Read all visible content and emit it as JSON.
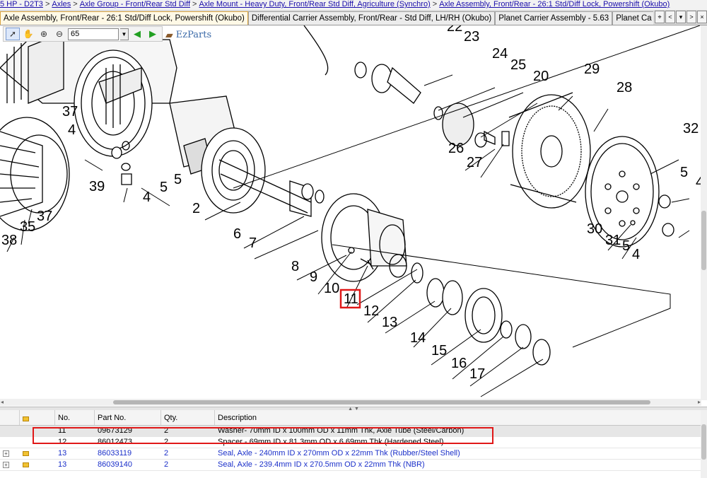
{
  "breadcrumb": {
    "items": [
      "5 HP - D2T3",
      "Axles",
      "Axle Group - Front/Rear Std Diff",
      "Axle Mount - Heavy Duty, Front/Rear Std Diff, Agriculture (Synchro)",
      "Axle Assembly, Front/Rear - 26:1 Std/Diff Lock, Powershift (Okubo)"
    ],
    "separator": ">"
  },
  "tabs": [
    {
      "label": "Axle Assembly, Front/Rear - 26:1 Std/Diff Lock, Powershift (Okubo)",
      "active": true
    },
    {
      "label": "Differential Carrier Assembly, Front/Rear - Std Diff, LH/RH (Okubo)",
      "active": false
    },
    {
      "label": "Planet Carrier Assembly - 5.63",
      "active": false
    },
    {
      "label": "Planet Ca",
      "active": false
    }
  ],
  "tab_controls": {
    "pin": "⌖",
    "prev": "<",
    "menu": "▾",
    "next": ">",
    "close": "×"
  },
  "toolbar": {
    "zoom_value": "65",
    "icons": [
      "pointer-icon",
      "pan-hand-icon",
      "zoom-in-icon",
      "zoom-out-icon",
      "back-arrow-icon",
      "forward-arrow-icon"
    ]
  },
  "logo": {
    "text": "EzParts"
  },
  "drawing": {
    "callouts": [
      "37",
      "4",
      "39",
      "5",
      "4",
      "5",
      "37",
      "35",
      "38",
      "2",
      "6",
      "7",
      "8",
      "9",
      "10",
      "11",
      "12",
      "13",
      "14",
      "15",
      "16",
      "17",
      "22",
      "23",
      "24",
      "25",
      "20",
      "29",
      "28",
      "26",
      "27",
      "32",
      "5",
      "30",
      "31",
      "5",
      "4",
      "4"
    ],
    "selected_callout": "11",
    "highlight_color": "#e01818"
  },
  "grid": {
    "columns": [
      "",
      "",
      "No.",
      "Part No.",
      "Qty.",
      "Description"
    ],
    "rows": [
      {
        "no": "11",
        "part": "09673129",
        "qty": "2",
        "desc": "Washer- 70mm ID x 100mm OD x 11mm Thk, Axle Tube (Steel/Carbon)",
        "selected": true,
        "link": false,
        "expandable": false,
        "folder": false
      },
      {
        "no": "12",
        "part": "86012473",
        "qty": "2",
        "desc": "Spacer - 69mm ID x 81.3mm OD x 6.69mm Thk (Hardened Steel)",
        "selected": false,
        "link": false,
        "expandable": false,
        "folder": false
      },
      {
        "no": "13",
        "part": "86033119",
        "qty": "2",
        "desc": "Seal, Axle - 240mm ID x 270mm OD x 22mm Thk (Rubber/Steel Shell)",
        "selected": false,
        "link": true,
        "expandable": true,
        "folder": true
      },
      {
        "no": "13",
        "part": "86039140",
        "qty": "2",
        "desc": "Seal, Axle - 239.4mm ID x 270.5mm OD x 22mm Thk (NBR)",
        "selected": false,
        "link": true,
        "expandable": true,
        "folder": true
      }
    ]
  }
}
